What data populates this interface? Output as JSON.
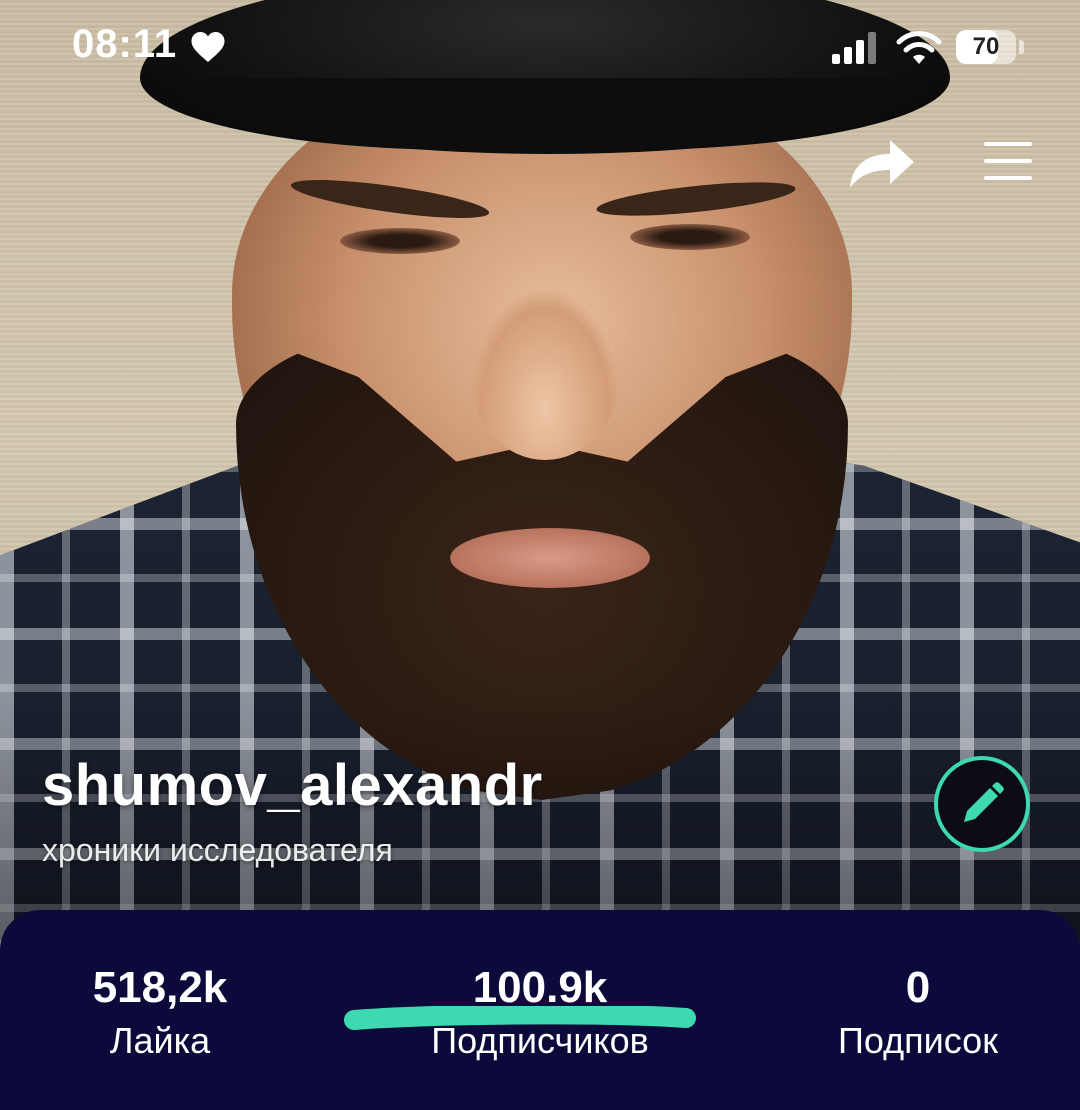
{
  "status_bar": {
    "time": "08:11",
    "battery_percent": 70,
    "battery_label": "70",
    "icons": [
      "heart-icon",
      "signal-icon",
      "wifi-icon",
      "battery-icon"
    ]
  },
  "header": {
    "icons": [
      "share-icon",
      "menu-icon"
    ]
  },
  "profile": {
    "username": "shumov_alexandr",
    "bio": "хроники исследователя",
    "edit_icon": "pencil-icon"
  },
  "stats": [
    {
      "value": "518,2k",
      "label": "Лайка"
    },
    {
      "value": "100.9k",
      "label": "Подписчиков"
    },
    {
      "value": "0",
      "label": "Подписок"
    }
  ],
  "colors": {
    "accent": "#3dd9b0",
    "panel_background": "#0c0a3a",
    "text": "#ffffff"
  }
}
